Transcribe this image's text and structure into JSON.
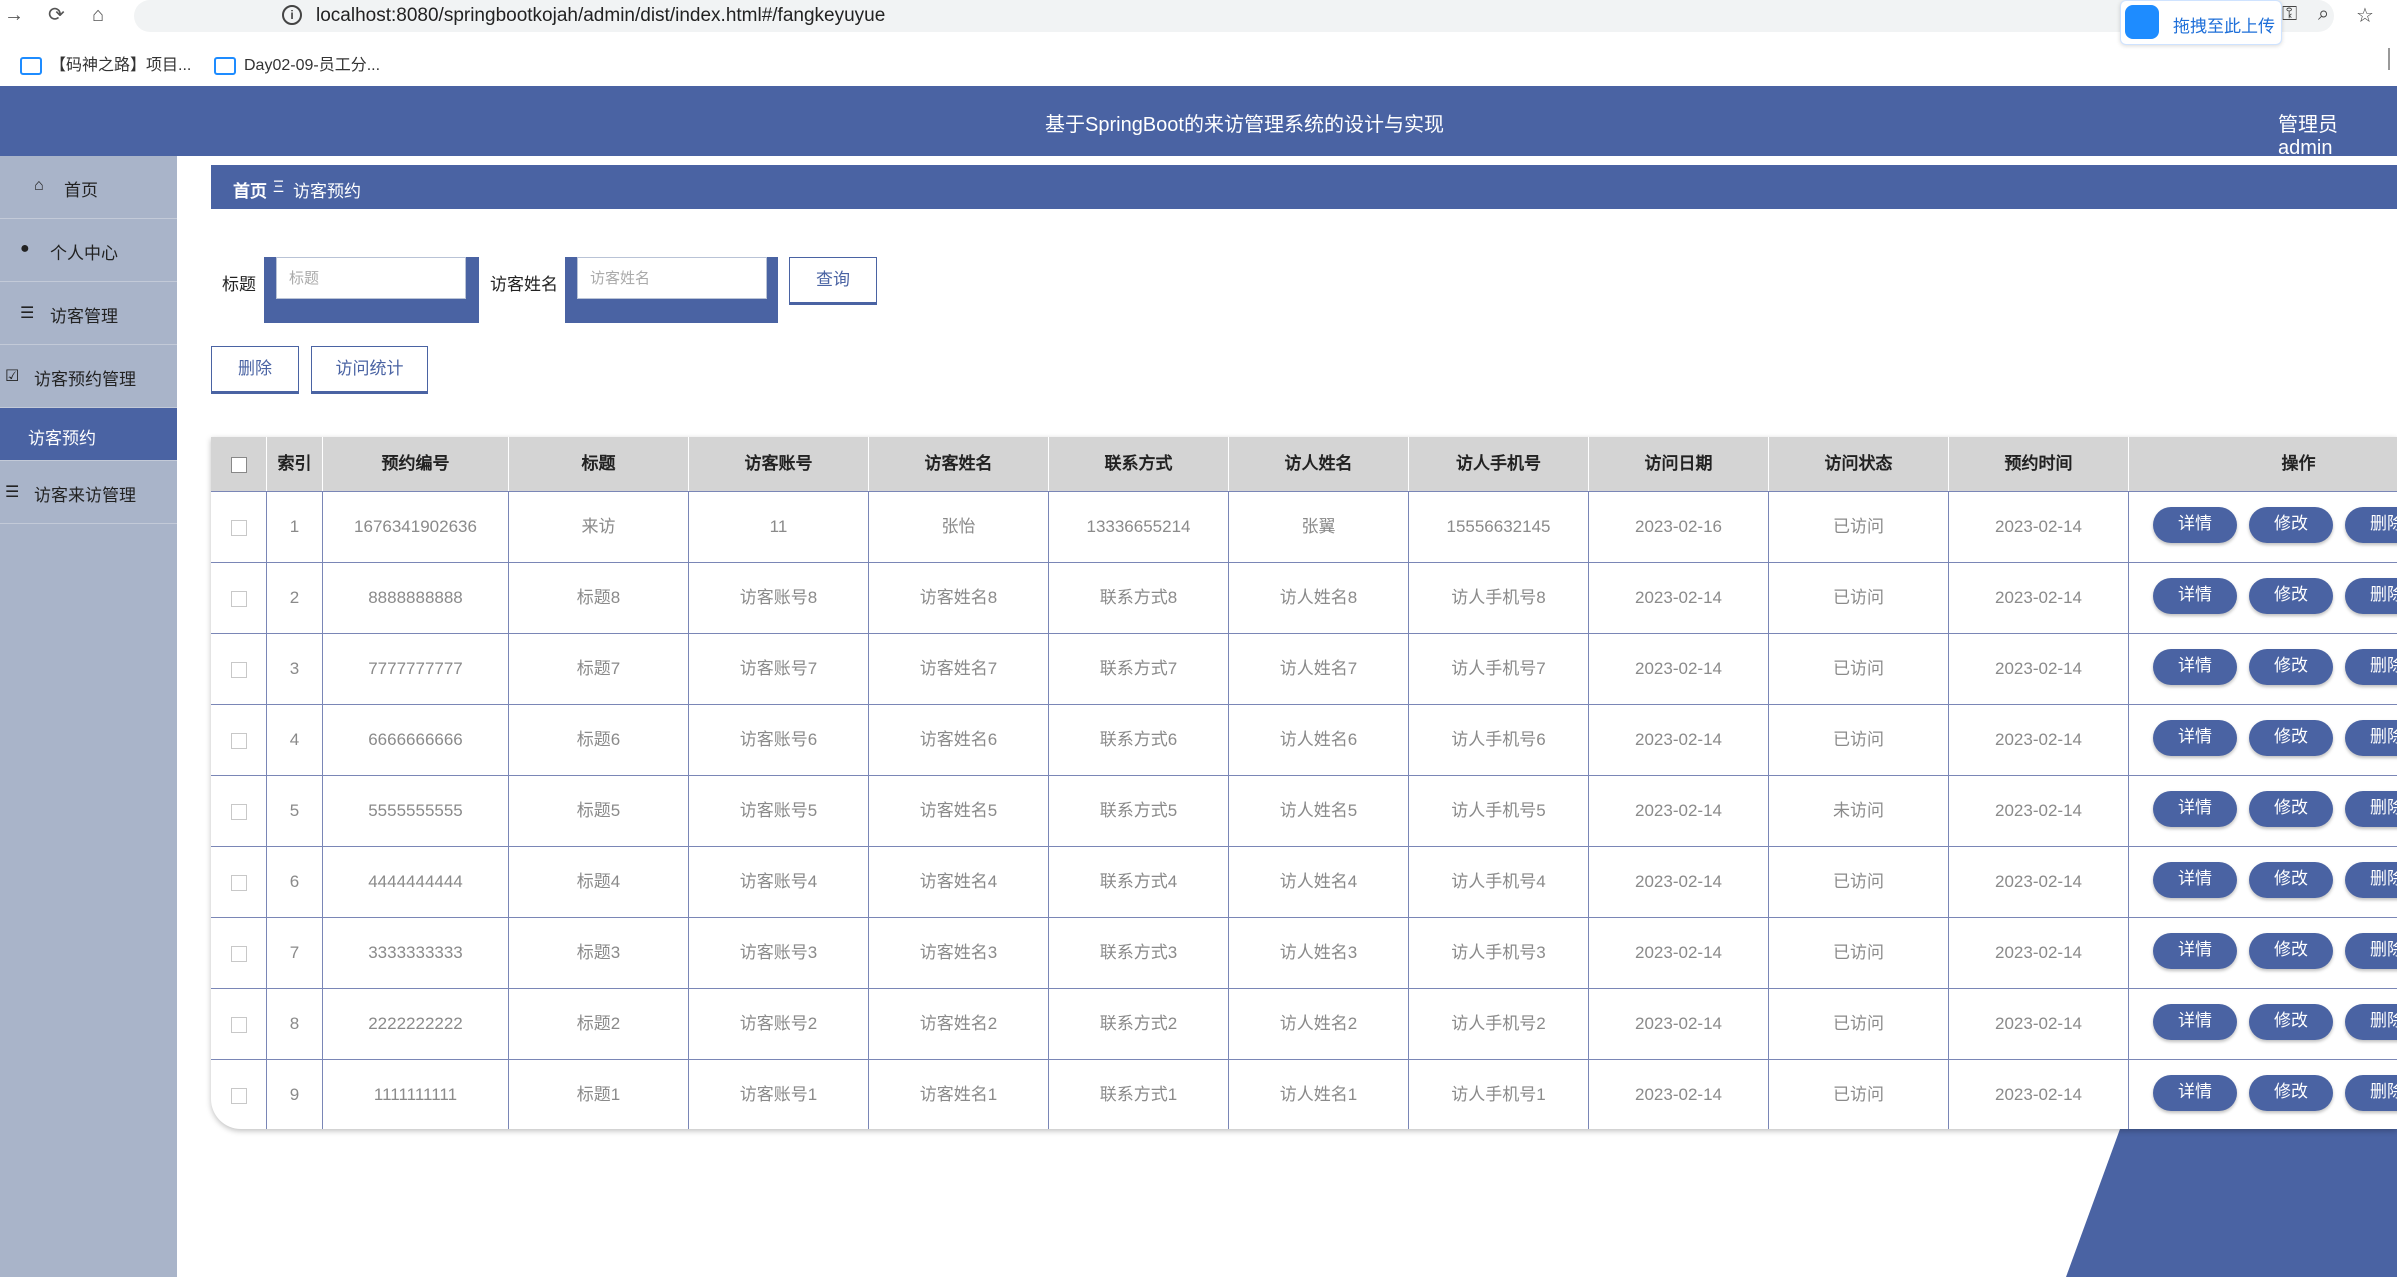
{
  "browser": {
    "url": "localhost:8080/springbootkojah/admin/dist/index.html#/fangkeyuyue",
    "upload_label": "拖拽至此上传",
    "bookmarks": [
      {
        "label": "【码神之路】项目..."
      },
      {
        "label": "Day02-09-员工分..."
      }
    ]
  },
  "header": {
    "title": "基于SpringBoot的来访管理系统的设计与实现",
    "user": "管理员 admin"
  },
  "sidebar": {
    "items": [
      {
        "label": "首页",
        "icon": "home-icon",
        "active": false
      },
      {
        "label": "个人中心",
        "icon": "user-icon",
        "active": false
      },
      {
        "label": "访客管理",
        "icon": "list-icon",
        "active": false
      },
      {
        "label": "访客预约管理",
        "icon": "clipboard-check-icon",
        "active": false
      },
      {
        "label": "访客预约",
        "icon": "",
        "active": true
      },
      {
        "label": "访客来访管理",
        "icon": "list-icon",
        "active": false
      }
    ]
  },
  "breadcrumb": {
    "home": "首页",
    "separator": "Ξ",
    "current": "访客预约"
  },
  "search": {
    "title_label": "标题",
    "title_placeholder": "标题",
    "name_label": "访客姓名",
    "name_placeholder": "访客姓名",
    "query_button": "查询"
  },
  "actions": {
    "delete_button": "删除",
    "stats_button": "访问统计"
  },
  "table": {
    "columns": [
      "索引",
      "预约编号",
      "标题",
      "访客账号",
      "访客姓名",
      "联系方式",
      "访人姓名",
      "访人手机号",
      "访问日期",
      "访问状态",
      "预约时间",
      "操作"
    ],
    "row_actions": [
      "详情",
      "修改",
      "删除"
    ],
    "rows": [
      {
        "index": "1",
        "booking_no": "1676341902636",
        "title": "来访",
        "account": "11",
        "visitor_name": "张怡",
        "contact": "13336655214",
        "host_name": "张翼",
        "host_phone": "15556632145",
        "visit_date": "2023-02-16",
        "status": "已访问",
        "booking_time": "2023-02-14"
      },
      {
        "index": "2",
        "booking_no": "8888888888",
        "title": "标题8",
        "account": "访客账号8",
        "visitor_name": "访客姓名8",
        "contact": "联系方式8",
        "host_name": "访人姓名8",
        "host_phone": "访人手机号8",
        "visit_date": "2023-02-14",
        "status": "已访问",
        "booking_time": "2023-02-14"
      },
      {
        "index": "3",
        "booking_no": "7777777777",
        "title": "标题7",
        "account": "访客账号7",
        "visitor_name": "访客姓名7",
        "contact": "联系方式7",
        "host_name": "访人姓名7",
        "host_phone": "访人手机号7",
        "visit_date": "2023-02-14",
        "status": "已访问",
        "booking_time": "2023-02-14"
      },
      {
        "index": "4",
        "booking_no": "6666666666",
        "title": "标题6",
        "account": "访客账号6",
        "visitor_name": "访客姓名6",
        "contact": "联系方式6",
        "host_name": "访人姓名6",
        "host_phone": "访人手机号6",
        "visit_date": "2023-02-14",
        "status": "已访问",
        "booking_time": "2023-02-14"
      },
      {
        "index": "5",
        "booking_no": "5555555555",
        "title": "标题5",
        "account": "访客账号5",
        "visitor_name": "访客姓名5",
        "contact": "联系方式5",
        "host_name": "访人姓名5",
        "host_phone": "访人手机号5",
        "visit_date": "2023-02-14",
        "status": "未访问",
        "booking_time": "2023-02-14"
      },
      {
        "index": "6",
        "booking_no": "4444444444",
        "title": "标题4",
        "account": "访客账号4",
        "visitor_name": "访客姓名4",
        "contact": "联系方式4",
        "host_name": "访人姓名4",
        "host_phone": "访人手机号4",
        "visit_date": "2023-02-14",
        "status": "已访问",
        "booking_time": "2023-02-14"
      },
      {
        "index": "7",
        "booking_no": "3333333333",
        "title": "标题3",
        "account": "访客账号3",
        "visitor_name": "访客姓名3",
        "contact": "联系方式3",
        "host_name": "访人姓名3",
        "host_phone": "访人手机号3",
        "visit_date": "2023-02-14",
        "status": "已访问",
        "booking_time": "2023-02-14"
      },
      {
        "index": "8",
        "booking_no": "2222222222",
        "title": "标题2",
        "account": "访客账号2",
        "visitor_name": "访客姓名2",
        "contact": "联系方式2",
        "host_name": "访人姓名2",
        "host_phone": "访人手机号2",
        "visit_date": "2023-02-14",
        "status": "已访问",
        "booking_time": "2023-02-14"
      },
      {
        "index": "9",
        "booking_no": "1111111111",
        "title": "标题1",
        "account": "访客账号1",
        "visitor_name": "访客姓名1",
        "contact": "联系方式1",
        "host_name": "访人姓名1",
        "host_phone": "访人手机号1",
        "visit_date": "2023-02-14",
        "status": "已访问",
        "booking_time": "2023-02-14"
      }
    ]
  },
  "colors": {
    "primary": "#4a63a3",
    "sidebar": "#a9b4c9",
    "table_header": "#d4d4d4",
    "row_border": "#7a86b6"
  }
}
